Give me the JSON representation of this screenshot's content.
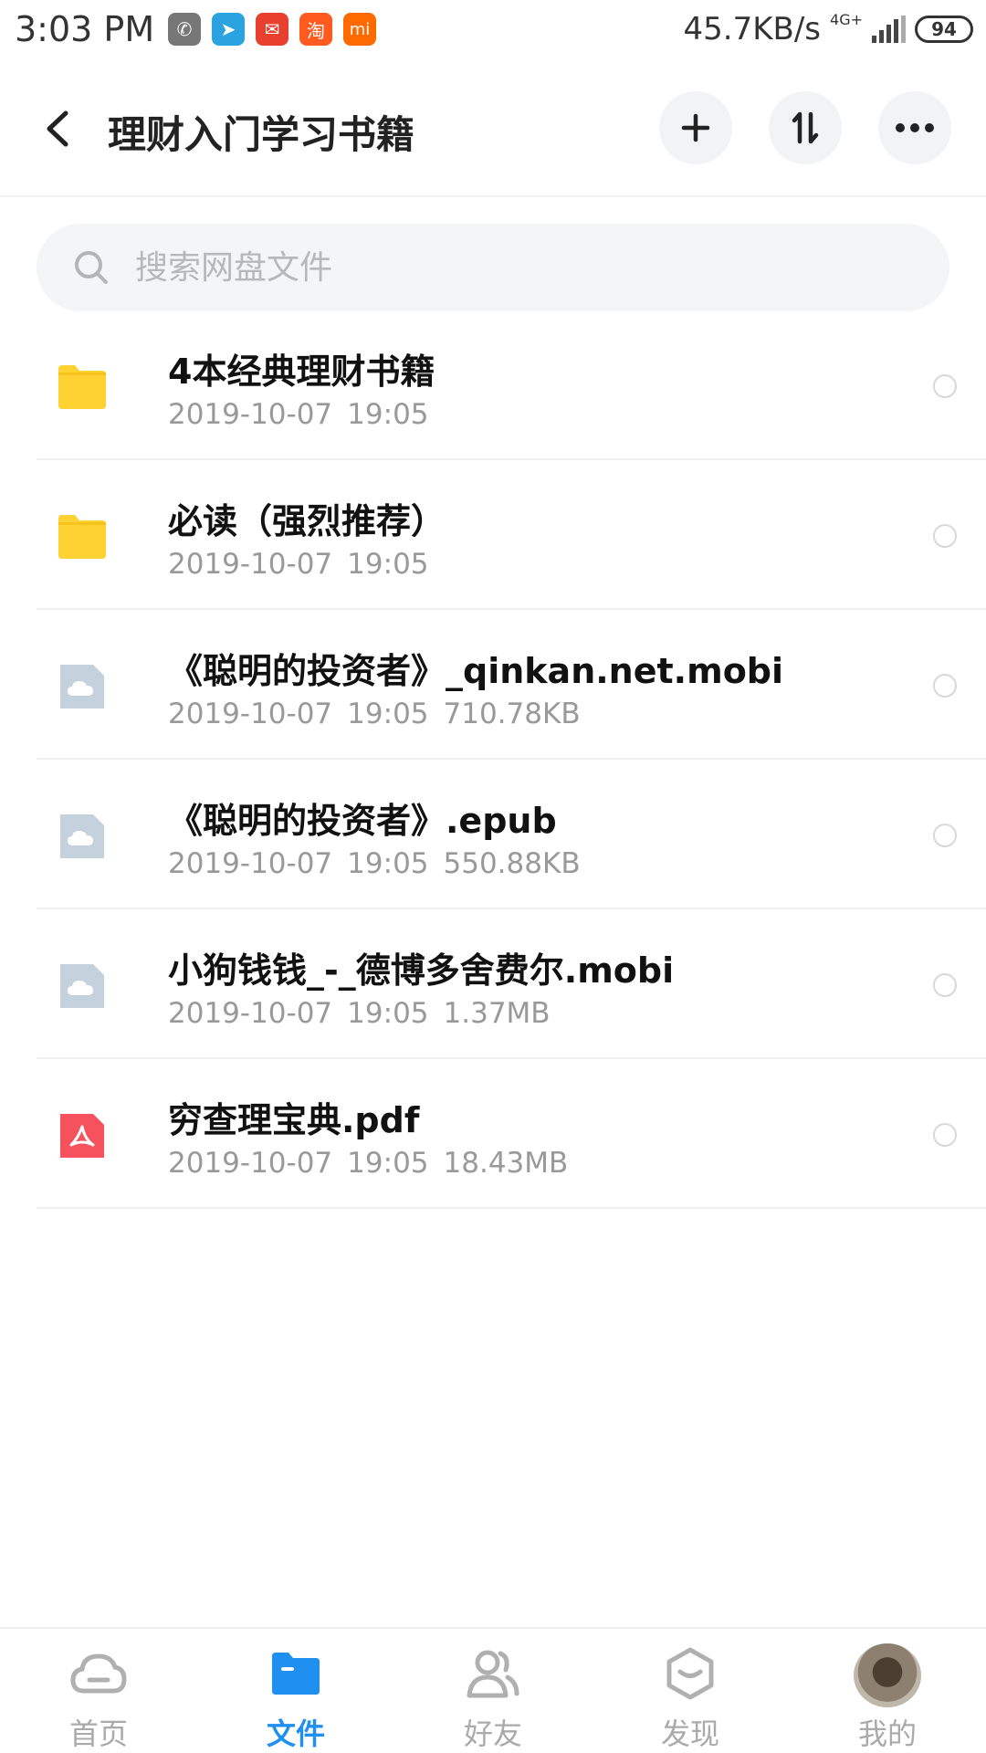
{
  "status_bar": {
    "time": "3:03 PM",
    "net_speed": "45.7KB/s",
    "network": "4G+",
    "battery": "94",
    "apps": [
      {
        "name": "wechat",
        "color": "#777777",
        "glyph": "✆"
      },
      {
        "name": "telegram",
        "color": "#2aa3e0",
        "glyph": "➤"
      },
      {
        "name": "red-app",
        "color": "#e8402f",
        "glyph": "✉"
      },
      {
        "name": "taobao",
        "color": "#ff5a1f",
        "glyph": "淘"
      },
      {
        "name": "mi",
        "color": "#ff6a00",
        "glyph": "mi"
      }
    ]
  },
  "header": {
    "title": "理财入门学习书籍"
  },
  "search": {
    "placeholder": "搜索网盘文件"
  },
  "files": [
    {
      "name": "4本经典理财书籍",
      "date": "2019-10-07",
      "time": "19:05",
      "size": "",
      "type": "folder"
    },
    {
      "name": "必读（强烈推荐）",
      "date": "2019-10-07",
      "time": "19:05",
      "size": "",
      "type": "folder"
    },
    {
      "name": "《聪明的投资者》_qinkan.net.mobi",
      "date": "2019-10-07",
      "time": "19:05",
      "size": "710.78KB",
      "type": "cloud-file"
    },
    {
      "name": "《聪明的投资者》.epub",
      "date": "2019-10-07",
      "time": "19:05",
      "size": "550.88KB",
      "type": "cloud-file"
    },
    {
      "name": "小狗钱钱_-_德博多舍费尔.mobi",
      "date": "2019-10-07",
      "time": "19:05",
      "size": "1.37MB",
      "type": "cloud-file"
    },
    {
      "name": "穷查理宝典.pdf",
      "date": "2019-10-07",
      "time": "19:05",
      "size": "18.43MB",
      "type": "pdf"
    }
  ],
  "bottom_nav": [
    {
      "label": "首页",
      "icon": "cloud-home-icon",
      "active": false
    },
    {
      "label": "文件",
      "icon": "folder-icon",
      "active": true
    },
    {
      "label": "好友",
      "icon": "friends-icon",
      "active": false
    },
    {
      "label": "发现",
      "icon": "discover-icon",
      "active": false
    },
    {
      "label": "我的",
      "icon": "avatar",
      "active": false
    }
  ],
  "colors": {
    "accent": "#1f8ff0",
    "folder": "#ffd233",
    "cloud_file": "#c5d2dd",
    "pdf": "#f5525d"
  }
}
